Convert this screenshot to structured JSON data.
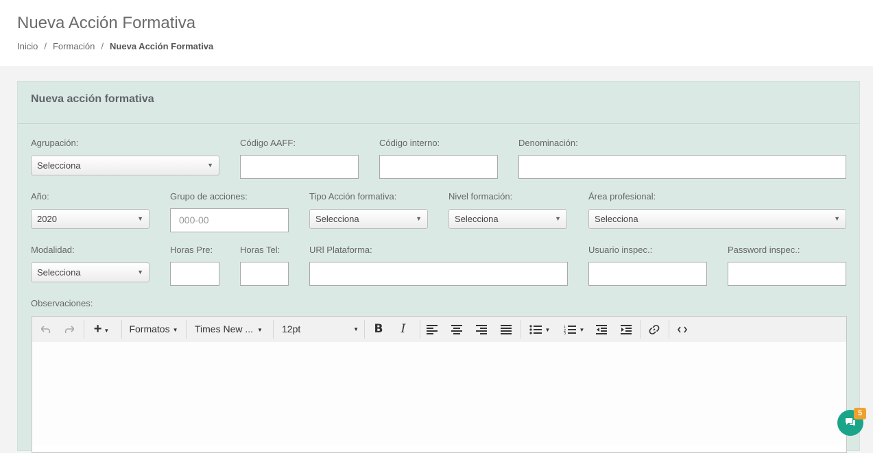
{
  "header": {
    "title": "Nueva Acción Formativa",
    "breadcrumb": [
      "Inicio",
      "Formación",
      "Nueva Acción Formativa"
    ]
  },
  "panel": {
    "title": "Nueva acción formativa"
  },
  "form": {
    "agrupacion": {
      "label": "Agrupación:",
      "value": "Selecciona"
    },
    "codigo_aaff": {
      "label": "Código AAFF:",
      "value": ""
    },
    "codigo_interno": {
      "label": "Código interno:",
      "value": ""
    },
    "denominacion": {
      "label": "Denominación:",
      "value": ""
    },
    "anio": {
      "label": "Año:",
      "value": "2020"
    },
    "grupo_acciones": {
      "label": "Grupo de acciones:",
      "placeholder": "000-00"
    },
    "tipo_accion": {
      "label": "Tipo Acción formativa:",
      "value": "Selecciona"
    },
    "nivel_formacion": {
      "label": "Nivel formación:",
      "value": "Selecciona"
    },
    "area_profesional": {
      "label": "Área profesional:",
      "value": "Selecciona"
    },
    "modalidad": {
      "label": "Modalidad:",
      "value": "Selecciona"
    },
    "horas_pre": {
      "label": "Horas Pre:",
      "value": ""
    },
    "horas_tel": {
      "label": "Horas Tel:",
      "value": ""
    },
    "url_plataforma": {
      "label": "URl Plataforma:",
      "value": ""
    },
    "usuario_inspec": {
      "label": "Usuario inspec.:",
      "value": ""
    },
    "password_inspec": {
      "label": "Password inspec.:",
      "value": ""
    },
    "observaciones": {
      "label": "Observaciones:"
    }
  },
  "editor": {
    "formats_label": "Formatos",
    "font_family": "Times New ...",
    "font_size": "12pt",
    "icons": [
      "undo-icon",
      "redo-icon",
      "insert-icon",
      "bold-icon",
      "italic-icon",
      "align-left-icon",
      "align-center-icon",
      "align-right-icon",
      "align-justify-icon",
      "bullet-list-icon",
      "numbered-list-icon",
      "outdent-icon",
      "indent-icon",
      "link-icon",
      "code-icon"
    ]
  },
  "chat": {
    "badge_count": "5",
    "accent": "#1aa58a",
    "badge_color": "#f0a12c"
  },
  "colors": {
    "panel_bg": "#dbe9e5"
  }
}
